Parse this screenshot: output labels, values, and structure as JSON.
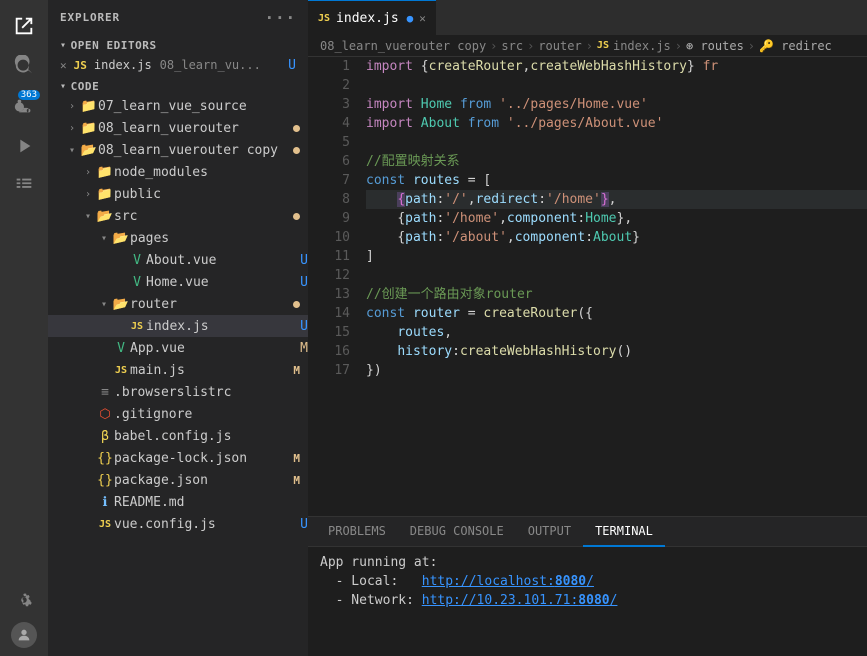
{
  "activityBar": {
    "icons": [
      {
        "name": "explorer-icon",
        "symbol": "📄",
        "active": true,
        "badge": null
      },
      {
        "name": "search-icon",
        "symbol": "🔍",
        "active": false,
        "badge": null
      },
      {
        "name": "source-control-icon",
        "symbol": "⎇",
        "active": false,
        "badge": "363"
      },
      {
        "name": "run-debug-icon",
        "symbol": "▶",
        "active": false,
        "badge": null
      },
      {
        "name": "extensions-icon",
        "symbol": "⊞",
        "active": false,
        "badge": null
      }
    ]
  },
  "sidebar": {
    "title": "EXPLORER",
    "openEditors": {
      "label": "OPEN EDITORS",
      "items": [
        {
          "name": "index.js",
          "path": "08_learn_vu...",
          "badge": "U",
          "badgeType": "u",
          "icon": "js"
        }
      ]
    },
    "code": {
      "label": "CODE",
      "items": [
        {
          "indent": 1,
          "label": "07_learn_vue_source",
          "type": "folder",
          "expanded": false,
          "badge": null,
          "badgeType": null
        },
        {
          "indent": 1,
          "label": "08_learn_vuerouter",
          "type": "folder",
          "expanded": false,
          "badge": "dot",
          "badgeType": "dot"
        },
        {
          "indent": 1,
          "label": "08_learn_vuerouter copy",
          "type": "folder",
          "expanded": true,
          "badge": "dot",
          "badgeType": "dot"
        },
        {
          "indent": 2,
          "label": "node_modules",
          "type": "folder",
          "expanded": false,
          "badge": null,
          "badgeType": null
        },
        {
          "indent": 2,
          "label": "public",
          "type": "folder",
          "expanded": false,
          "badge": null,
          "badgeType": null
        },
        {
          "indent": 2,
          "label": "src",
          "type": "folder",
          "expanded": true,
          "badge": "dot",
          "badgeType": "dot"
        },
        {
          "indent": 3,
          "label": "pages",
          "type": "folder",
          "expanded": true,
          "badge": null,
          "badgeType": null
        },
        {
          "indent": 4,
          "label": "About.vue",
          "type": "file",
          "icon": "vue",
          "badge": "U",
          "badgeType": "u"
        },
        {
          "indent": 4,
          "label": "Home.vue",
          "type": "file",
          "icon": "vue",
          "badge": "U",
          "badgeType": "u"
        },
        {
          "indent": 3,
          "label": "router",
          "type": "folder",
          "expanded": true,
          "badge": "dot",
          "badgeType": "dot"
        },
        {
          "indent": 4,
          "label": "index.js",
          "type": "file",
          "icon": "js",
          "badge": "U",
          "badgeType": "u",
          "active": true
        },
        {
          "indent": 3,
          "label": "App.vue",
          "type": "file",
          "icon": "vue",
          "badge": "M",
          "badgeType": "m"
        },
        {
          "indent": 3,
          "label": "main.js",
          "type": "file",
          "icon": "js",
          "badge": "M",
          "badgeType": "m"
        },
        {
          "indent": 2,
          "label": ".browserslistrc",
          "type": "file",
          "icon": "list",
          "badge": null,
          "badgeType": null
        },
        {
          "indent": 2,
          "label": ".gitignore",
          "type": "file",
          "icon": "git",
          "badge": null,
          "badgeType": null
        },
        {
          "indent": 2,
          "label": "babel.config.js",
          "type": "file",
          "icon": "babel",
          "badge": null,
          "badgeType": null
        },
        {
          "indent": 2,
          "label": "package-lock.json",
          "type": "file",
          "icon": "json",
          "badge": "M",
          "badgeType": "m"
        },
        {
          "indent": 2,
          "label": "package.json",
          "type": "file",
          "icon": "json",
          "badge": "M",
          "badgeType": "m"
        },
        {
          "indent": 2,
          "label": "README.md",
          "type": "file",
          "icon": "info",
          "badge": null,
          "badgeType": null
        },
        {
          "indent": 2,
          "label": "vue.config.js",
          "type": "file",
          "icon": "js",
          "badge": "U",
          "badgeType": "u"
        }
      ]
    }
  },
  "editor": {
    "tabs": [
      {
        "label": "index.js",
        "modified": true,
        "active": true,
        "icon": "js"
      }
    ],
    "breadcrumb": [
      "08_learn_vuerouter copy",
      "src",
      "router",
      "JS index.js",
      "routes",
      "redirect"
    ],
    "filename": "index.js",
    "lines": [
      {
        "num": 1,
        "tokens": [
          {
            "t": "imp",
            "v": "import"
          },
          {
            "t": "punc",
            "v": " {"
          },
          {
            "t": "fn",
            "v": "createRouter"
          },
          {
            "t": "punc",
            "v": ","
          },
          {
            "t": "fn",
            "v": "createWebHashHistory"
          },
          {
            "t": "punc",
            "v": "} fr"
          }
        ]
      },
      {
        "num": 2,
        "tokens": []
      },
      {
        "num": 3,
        "tokens": [
          {
            "t": "imp",
            "v": "import"
          },
          {
            "t": "op",
            "v": " "
          },
          {
            "t": "ident",
            "v": "Home"
          },
          {
            "t": "op",
            "v": " "
          },
          {
            "t": "kw",
            "v": "from"
          },
          {
            "t": "op",
            "v": " "
          },
          {
            "t": "str",
            "v": "'../pages/Home.vue'"
          }
        ]
      },
      {
        "num": 4,
        "tokens": [
          {
            "t": "imp",
            "v": "import"
          },
          {
            "t": "op",
            "v": " "
          },
          {
            "t": "ident",
            "v": "About"
          },
          {
            "t": "op",
            "v": " "
          },
          {
            "t": "kw",
            "v": "from"
          },
          {
            "t": "op",
            "v": " "
          },
          {
            "t": "str",
            "v": "'../pages/About.vue'"
          }
        ]
      },
      {
        "num": 5,
        "tokens": []
      },
      {
        "num": 6,
        "tokens": [
          {
            "t": "cmt",
            "v": "//配置映射关系"
          }
        ]
      },
      {
        "num": 7,
        "tokens": [
          {
            "t": "kw",
            "v": "const"
          },
          {
            "t": "op",
            "v": " "
          },
          {
            "t": "var",
            "v": "routes"
          },
          {
            "t": "op",
            "v": " = ["
          }
        ]
      },
      {
        "num": 8,
        "tokens": [
          {
            "t": "op",
            "v": "    "
          },
          {
            "t": "selected",
            "v": "{"
          },
          {
            "t": "prop",
            "v": "path"
          },
          {
            "t": "op",
            "v": ":"
          },
          {
            "t": "str",
            "v": "'/'"
          },
          {
            "t": "op",
            "v": ","
          },
          {
            "t": "prop",
            "v": "redirect"
          },
          {
            "t": "op",
            "v": ":"
          },
          {
            "t": "str",
            "v": "'/home'"
          },
          {
            "t": "selected-end",
            "v": "}"
          },
          {
            "t": "op",
            "v": ","
          }
        ],
        "highlighted": true
      },
      {
        "num": 9,
        "tokens": [
          {
            "t": "op",
            "v": "    {"
          },
          {
            "t": "prop",
            "v": "path"
          },
          {
            "t": "op",
            "v": ":"
          },
          {
            "t": "str",
            "v": "'/home'"
          },
          {
            "t": "op",
            "v": ","
          },
          {
            "t": "prop",
            "v": "component"
          },
          {
            "t": "op",
            "v": ":"
          },
          {
            "t": "ident",
            "v": "Home"
          },
          {
            "t": "op",
            "v": "},"
          }
        ]
      },
      {
        "num": 10,
        "tokens": [
          {
            "t": "op",
            "v": "    {"
          },
          {
            "t": "prop",
            "v": "path"
          },
          {
            "t": "op",
            "v": ":"
          },
          {
            "t": "str",
            "v": "'/about'"
          },
          {
            "t": "op",
            "v": ","
          },
          {
            "t": "prop",
            "v": "component"
          },
          {
            "t": "op",
            "v": ":"
          },
          {
            "t": "ident",
            "v": "About"
          },
          {
            "t": "op",
            "v": "}"
          }
        ]
      },
      {
        "num": 11,
        "tokens": [
          {
            "t": "op",
            "v": "]"
          }
        ]
      },
      {
        "num": 12,
        "tokens": []
      },
      {
        "num": 13,
        "tokens": [
          {
            "t": "cmt",
            "v": "//创建一个路由对象router"
          }
        ]
      },
      {
        "num": 14,
        "tokens": [
          {
            "t": "kw",
            "v": "const"
          },
          {
            "t": "op",
            "v": " "
          },
          {
            "t": "var",
            "v": "router"
          },
          {
            "t": "op",
            "v": " = "
          },
          {
            "t": "fn",
            "v": "createRouter"
          },
          {
            "t": "op",
            "v": "({"
          }
        ]
      },
      {
        "num": 15,
        "tokens": [
          {
            "t": "op",
            "v": "    "
          },
          {
            "t": "var",
            "v": "routes"
          },
          {
            "t": "op",
            "v": ","
          }
        ]
      },
      {
        "num": 16,
        "tokens": [
          {
            "t": "op",
            "v": "    "
          },
          {
            "t": "prop",
            "v": "history"
          },
          {
            "t": "op",
            "v": ":"
          },
          {
            "t": "fn",
            "v": "createWebHashHistory"
          },
          {
            "t": "op",
            "v": "()"
          }
        ]
      },
      {
        "num": 17,
        "tokens": [
          {
            "t": "op",
            "v": "})"
          }
        ]
      }
    ]
  },
  "panel": {
    "tabs": [
      "PROBLEMS",
      "DEBUG CONSOLE",
      "OUTPUT",
      "TERMINAL"
    ],
    "activeTab": "TERMINAL",
    "terminalLines": [
      "App running at:",
      "  - Local:   http://localhost:8080/",
      "  - Network: http://10.23.101.71:8080/"
    ]
  }
}
